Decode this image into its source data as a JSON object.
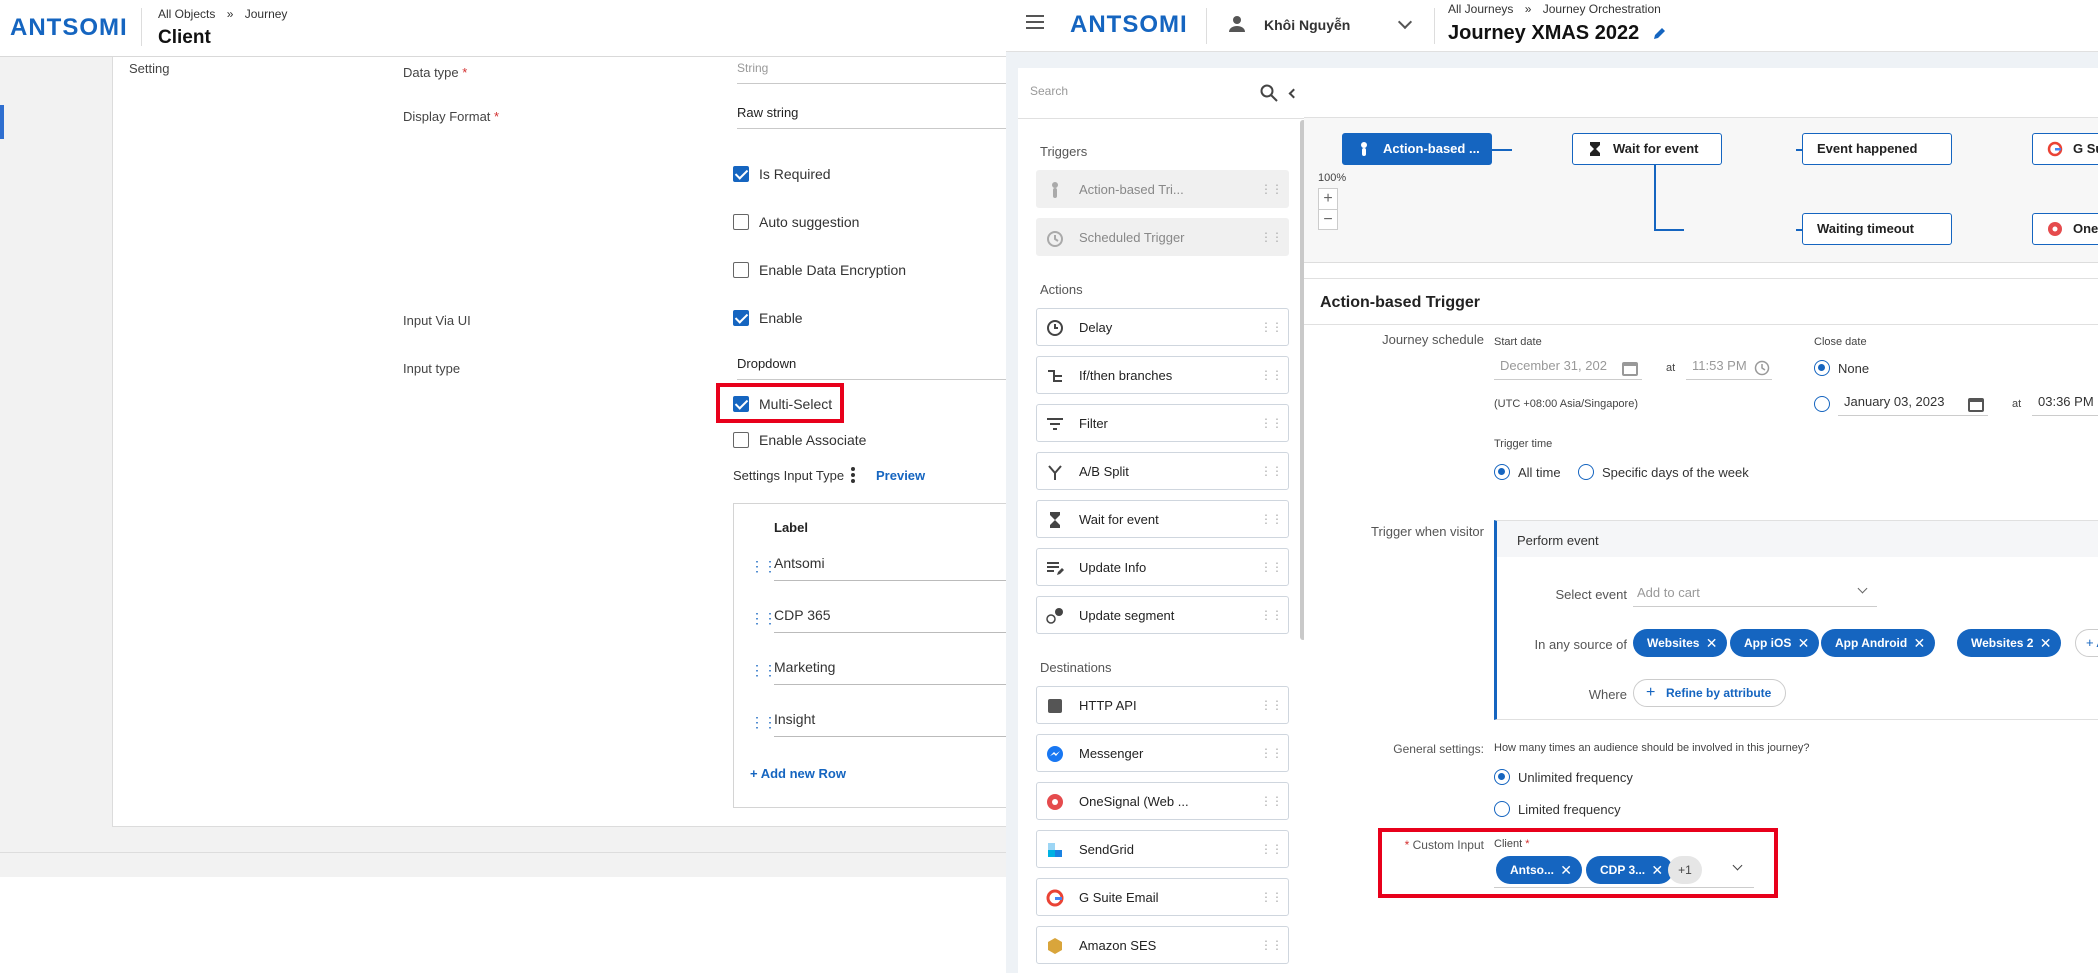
{
  "left": {
    "logo": "ANTSOMI",
    "breadcrumb": {
      "root": "All Objects",
      "sep": "»",
      "current": "Journey"
    },
    "title": "Client",
    "setting_label": "Setting",
    "data_type": {
      "label": "Data type",
      "required": "*",
      "value": "String"
    },
    "display_format": {
      "label": "Display Format",
      "required": "*",
      "value": "Raw string"
    },
    "is_required": "Is Required",
    "auto_suggestion": "Auto suggestion",
    "enable_encryption": "Enable Data Encryption",
    "input_via_ui": {
      "label": "Input Via UI",
      "option": "Enable"
    },
    "input_type": {
      "label": "Input type",
      "value": "Dropdown"
    },
    "multi_select": "Multi-Select",
    "enable_associate": "Enable Associate",
    "settings_input_type": "Settings Input Type",
    "preview": "Preview",
    "table_header": "Label",
    "rows": [
      "Antsomi",
      "CDP 365",
      "Marketing",
      "Insight"
    ],
    "add_row": "+ Add new Row"
  },
  "right": {
    "logo": "ANTSOMI",
    "user": "Khôi Nguyễn",
    "breadcrumb": {
      "root": "All Journeys",
      "sep": "»",
      "current": "Journey Orchestration"
    },
    "title": "Journey XMAS 2022",
    "search_placeholder": "Search",
    "sections": {
      "triggers": "Triggers",
      "actions": "Actions",
      "destinations": "Destinations"
    },
    "triggers": [
      "Action-based Tri...",
      "Scheduled Trigger"
    ],
    "actions": [
      "Delay",
      "If/then branches",
      "Filter",
      "A/B Split",
      "Wait for event",
      "Update Info",
      "Update segment"
    ],
    "destinations": [
      "HTTP API",
      "Messenger",
      "OneSignal (Web ...",
      "SendGrid",
      "G Suite Email",
      "Amazon SES"
    ],
    "flow": {
      "zoom": "100%",
      "zoom_in": "+",
      "zoom_out": "−",
      "nodes": [
        "Action-based ...",
        "Wait for event",
        "Event happened",
        "G Su",
        "Waiting timeout",
        "One"
      ]
    },
    "detail": {
      "title": "Action-based Trigger",
      "journey_schedule": "Journey schedule",
      "start_date_label": "Start date",
      "start_date": "December 31, 202",
      "at": "at",
      "start_time": "11:53 PM",
      "timezone": "(UTC +08:00 Asia/Singapore)",
      "close_date_label": "Close date",
      "close_none": "None",
      "close_date": "January 03, 2023",
      "close_time": "03:36 PM",
      "trigger_time_label": "Trigger time",
      "trigger_all": "All time",
      "trigger_specific": "Specific days of the week",
      "trigger_when": "Trigger when visitor",
      "perform_event": "Perform event",
      "select_event_label": "Select event",
      "select_event_value": "Add to cart",
      "source_label": "In any source of",
      "sources": [
        "Websites",
        "App iOS",
        "App Android",
        "Websites 2"
      ],
      "add_source": "+ A",
      "where_label": "Where",
      "refine": "Refine by attribute",
      "general_label": "General settings:",
      "general_question": "How many times an audience should be involved in this journey?",
      "unlimited": "Unlimited frequency",
      "limited": "Limited frequency",
      "custom_input_required": "*",
      "custom_input_label": "Custom Input",
      "client_label": "Client",
      "client_required": "*",
      "client_tags": [
        "Antso...",
        "CDP 3..."
      ],
      "client_more": "+1"
    }
  }
}
